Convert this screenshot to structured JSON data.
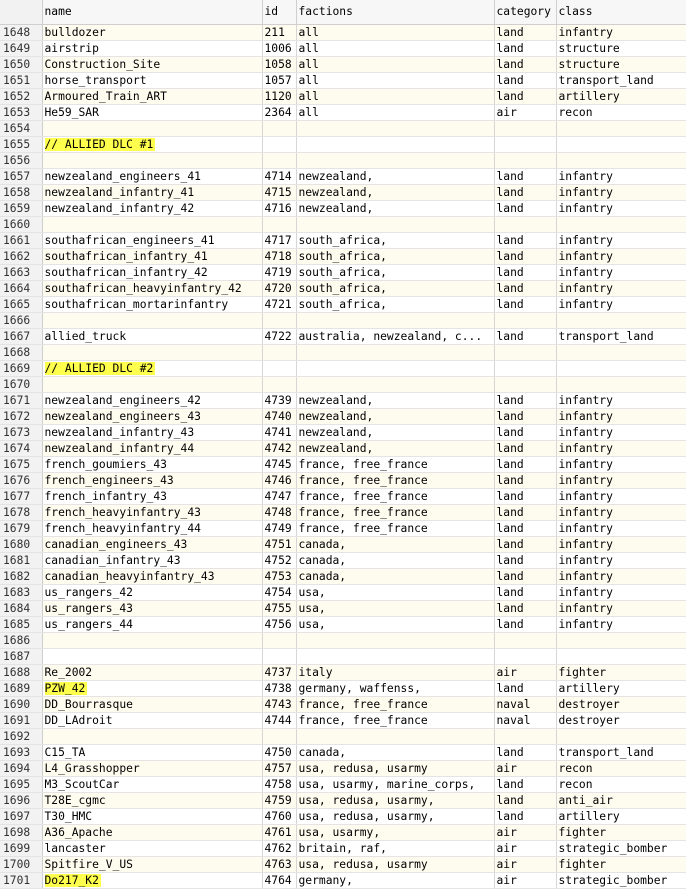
{
  "columns": [
    "name",
    "id",
    "factions",
    "category",
    "class"
  ],
  "rows": [
    {
      "n": "1648",
      "name": "bulldozer",
      "id": "211",
      "factions": "all",
      "category": "land",
      "class": "infantry"
    },
    {
      "n": "1649",
      "name": "airstrip",
      "id": "1006",
      "factions": "all",
      "category": "land",
      "class": "structure"
    },
    {
      "n": "1650",
      "name": "Construction_Site",
      "id": "1058",
      "factions": "all",
      "category": "land",
      "class": "structure"
    },
    {
      "n": "1651",
      "name": "horse_transport",
      "id": "1057",
      "factions": "all",
      "category": "land",
      "class": "transport_land"
    },
    {
      "n": "1652",
      "name": "Armoured_Train_ART",
      "id": "1120",
      "factions": "all",
      "category": "land",
      "class": "artillery"
    },
    {
      "n": "1653",
      "name": "He59_SAR",
      "id": "2364",
      "factions": "all",
      "category": "air",
      "class": "recon"
    },
    {
      "n": "1654",
      "name": "",
      "id": "",
      "factions": "",
      "category": "",
      "class": ""
    },
    {
      "n": "1655",
      "name": "// ALLIED DLC #1",
      "id": "",
      "factions": "",
      "category": "",
      "class": "",
      "highlight": true
    },
    {
      "n": "1656",
      "name": "",
      "id": "",
      "factions": "",
      "category": "",
      "class": ""
    },
    {
      "n": "1657",
      "name": "newzealand_engineers_41",
      "id": "4714",
      "factions": "newzealand,",
      "category": "land",
      "class": "infantry"
    },
    {
      "n": "1658",
      "name": "newzealand_infantry_41",
      "id": "4715",
      "factions": "newzealand,",
      "category": "land",
      "class": "infantry"
    },
    {
      "n": "1659",
      "name": "newzealand_infantry_42",
      "id": "4716",
      "factions": "newzealand,",
      "category": "land",
      "class": "infantry"
    },
    {
      "n": "1660",
      "name": "",
      "id": "",
      "factions": "",
      "category": "",
      "class": ""
    },
    {
      "n": "1661",
      "name": "southafrican_engineers_41",
      "id": "4717",
      "factions": "south_africa,",
      "category": "land",
      "class": "infantry"
    },
    {
      "n": "1662",
      "name": "southafrican_infantry_41",
      "id": "4718",
      "factions": "south_africa,",
      "category": "land",
      "class": "infantry"
    },
    {
      "n": "1663",
      "name": "southafrican_infantry_42",
      "id": "4719",
      "factions": "south_africa,",
      "category": "land",
      "class": "infantry"
    },
    {
      "n": "1664",
      "name": "southafrican_heavyinfantry_42",
      "id": "4720",
      "factions": "south_africa,",
      "category": "land",
      "class": "infantry"
    },
    {
      "n": "1665",
      "name": "southafrican_mortarinfantry",
      "id": "4721",
      "factions": "south_africa,",
      "category": "land",
      "class": "infantry"
    },
    {
      "n": "1666",
      "name": "",
      "id": "",
      "factions": "",
      "category": "",
      "class": ""
    },
    {
      "n": "1667",
      "name": "allied_truck",
      "id": "4722",
      "factions": "australia, newzealand, c...",
      "category": "land",
      "class": "transport_land"
    },
    {
      "n": "1668",
      "name": "",
      "id": "",
      "factions": "",
      "category": "",
      "class": ""
    },
    {
      "n": "1669",
      "name": "// ALLIED DLC #2",
      "id": "",
      "factions": "",
      "category": "",
      "class": "",
      "highlight": true
    },
    {
      "n": "1670",
      "name": "",
      "id": "",
      "factions": "",
      "category": "",
      "class": ""
    },
    {
      "n": "1671",
      "name": "newzealand_engineers_42",
      "id": "4739",
      "factions": "newzealand,",
      "category": "land",
      "class": "infantry"
    },
    {
      "n": "1672",
      "name": "newzealand_engineers_43",
      "id": "4740",
      "factions": "newzealand,",
      "category": "land",
      "class": "infantry"
    },
    {
      "n": "1673",
      "name": "newzealand_infantry_43",
      "id": "4741",
      "factions": "newzealand,",
      "category": "land",
      "class": "infantry"
    },
    {
      "n": "1674",
      "name": "newzealand_infantry_44",
      "id": "4742",
      "factions": "newzealand,",
      "category": "land",
      "class": "infantry"
    },
    {
      "n": "1675",
      "name": "french_goumiers_43",
      "id": "4745",
      "factions": "france, free_france",
      "category": "land",
      "class": "infantry"
    },
    {
      "n": "1676",
      "name": "french_engineers_43",
      "id": "4746",
      "factions": "france, free_france",
      "category": "land",
      "class": "infantry"
    },
    {
      "n": "1677",
      "name": "french_infantry_43",
      "id": "4747",
      "factions": "france, free_france",
      "category": "land",
      "class": "infantry"
    },
    {
      "n": "1678",
      "name": "french_heavyinfantry_43",
      "id": "4748",
      "factions": "france, free_france",
      "category": "land",
      "class": "infantry"
    },
    {
      "n": "1679",
      "name": "french_heavyinfantry_44",
      "id": "4749",
      "factions": "france, free_france",
      "category": "land",
      "class": "infantry"
    },
    {
      "n": "1680",
      "name": "canadian_engineers_43",
      "id": "4751",
      "factions": "canada,",
      "category": "land",
      "class": "infantry"
    },
    {
      "n": "1681",
      "name": "canadian_infantry_43",
      "id": "4752",
      "factions": "canada,",
      "category": "land",
      "class": "infantry"
    },
    {
      "n": "1682",
      "name": "canadian_heavyinfantry_43",
      "id": "4753",
      "factions": "canada,",
      "category": "land",
      "class": "infantry"
    },
    {
      "n": "1683",
      "name": "us_rangers_42",
      "id": "4754",
      "factions": "usa,",
      "category": "land",
      "class": "infantry"
    },
    {
      "n": "1684",
      "name": "us_rangers_43",
      "id": "4755",
      "factions": "usa,",
      "category": "land",
      "class": "infantry"
    },
    {
      "n": "1685",
      "name": "us_rangers_44",
      "id": "4756",
      "factions": "usa,",
      "category": "land",
      "class": "infantry"
    },
    {
      "n": "1686",
      "name": "",
      "id": "",
      "factions": "",
      "category": "",
      "class": ""
    },
    {
      "n": "1687",
      "name": "",
      "id": "",
      "factions": "",
      "category": "",
      "class": ""
    },
    {
      "n": "1688",
      "name": "Re_2002",
      "id": "4737",
      "factions": "italy",
      "category": "air",
      "class": "fighter"
    },
    {
      "n": "1689",
      "name": "PZW_42",
      "id": "4738",
      "factions": "germany, waffenss,",
      "category": "land",
      "class": "artillery",
      "highlight": true
    },
    {
      "n": "1690",
      "name": "DD_Bourrasque",
      "id": "4743",
      "factions": "france, free_france",
      "category": "naval",
      "class": "destroyer"
    },
    {
      "n": "1691",
      "name": "DD_LAdroit",
      "id": "4744",
      "factions": "france, free_france",
      "category": "naval",
      "class": "destroyer"
    },
    {
      "n": "1692",
      "name": "",
      "id": "",
      "factions": "",
      "category": "",
      "class": ""
    },
    {
      "n": "1693",
      "name": "C15_TA",
      "id": "4750",
      "factions": "canada,",
      "category": "land",
      "class": "transport_land"
    },
    {
      "n": "1694",
      "name": "L4_Grasshopper",
      "id": "4757",
      "factions": "usa, redusa, usarmy",
      "category": "air",
      "class": "recon"
    },
    {
      "n": "1695",
      "name": "M3_ScoutCar",
      "id": "4758",
      "factions": "usa, usarmy, marine_corps,",
      "category": "land",
      "class": "recon"
    },
    {
      "n": "1696",
      "name": "T28E_cgmc",
      "id": "4759",
      "factions": "usa, redusa, usarmy,",
      "category": "land",
      "class": "anti_air"
    },
    {
      "n": "1697",
      "name": "T30_HMC",
      "id": "4760",
      "factions": "usa, redusa, usarmy,",
      "category": "land",
      "class": "artillery"
    },
    {
      "n": "1698",
      "name": "A36_Apache",
      "id": "4761",
      "factions": "usa, usarmy,",
      "category": "air",
      "class": "fighter"
    },
    {
      "n": "1699",
      "name": "lancaster",
      "id": "4762",
      "factions": "britain, raf,",
      "category": "air",
      "class": "strategic_bomber"
    },
    {
      "n": "1700",
      "name": "Spitfire_V_US",
      "id": "4763",
      "factions": "usa, redusa, usarmy",
      "category": "air",
      "class": "fighter"
    },
    {
      "n": "1701",
      "name": "Do217_K2",
      "id": "4764",
      "factions": "germany,",
      "category": "air",
      "class": "strategic_bomber",
      "highlight": true
    }
  ]
}
